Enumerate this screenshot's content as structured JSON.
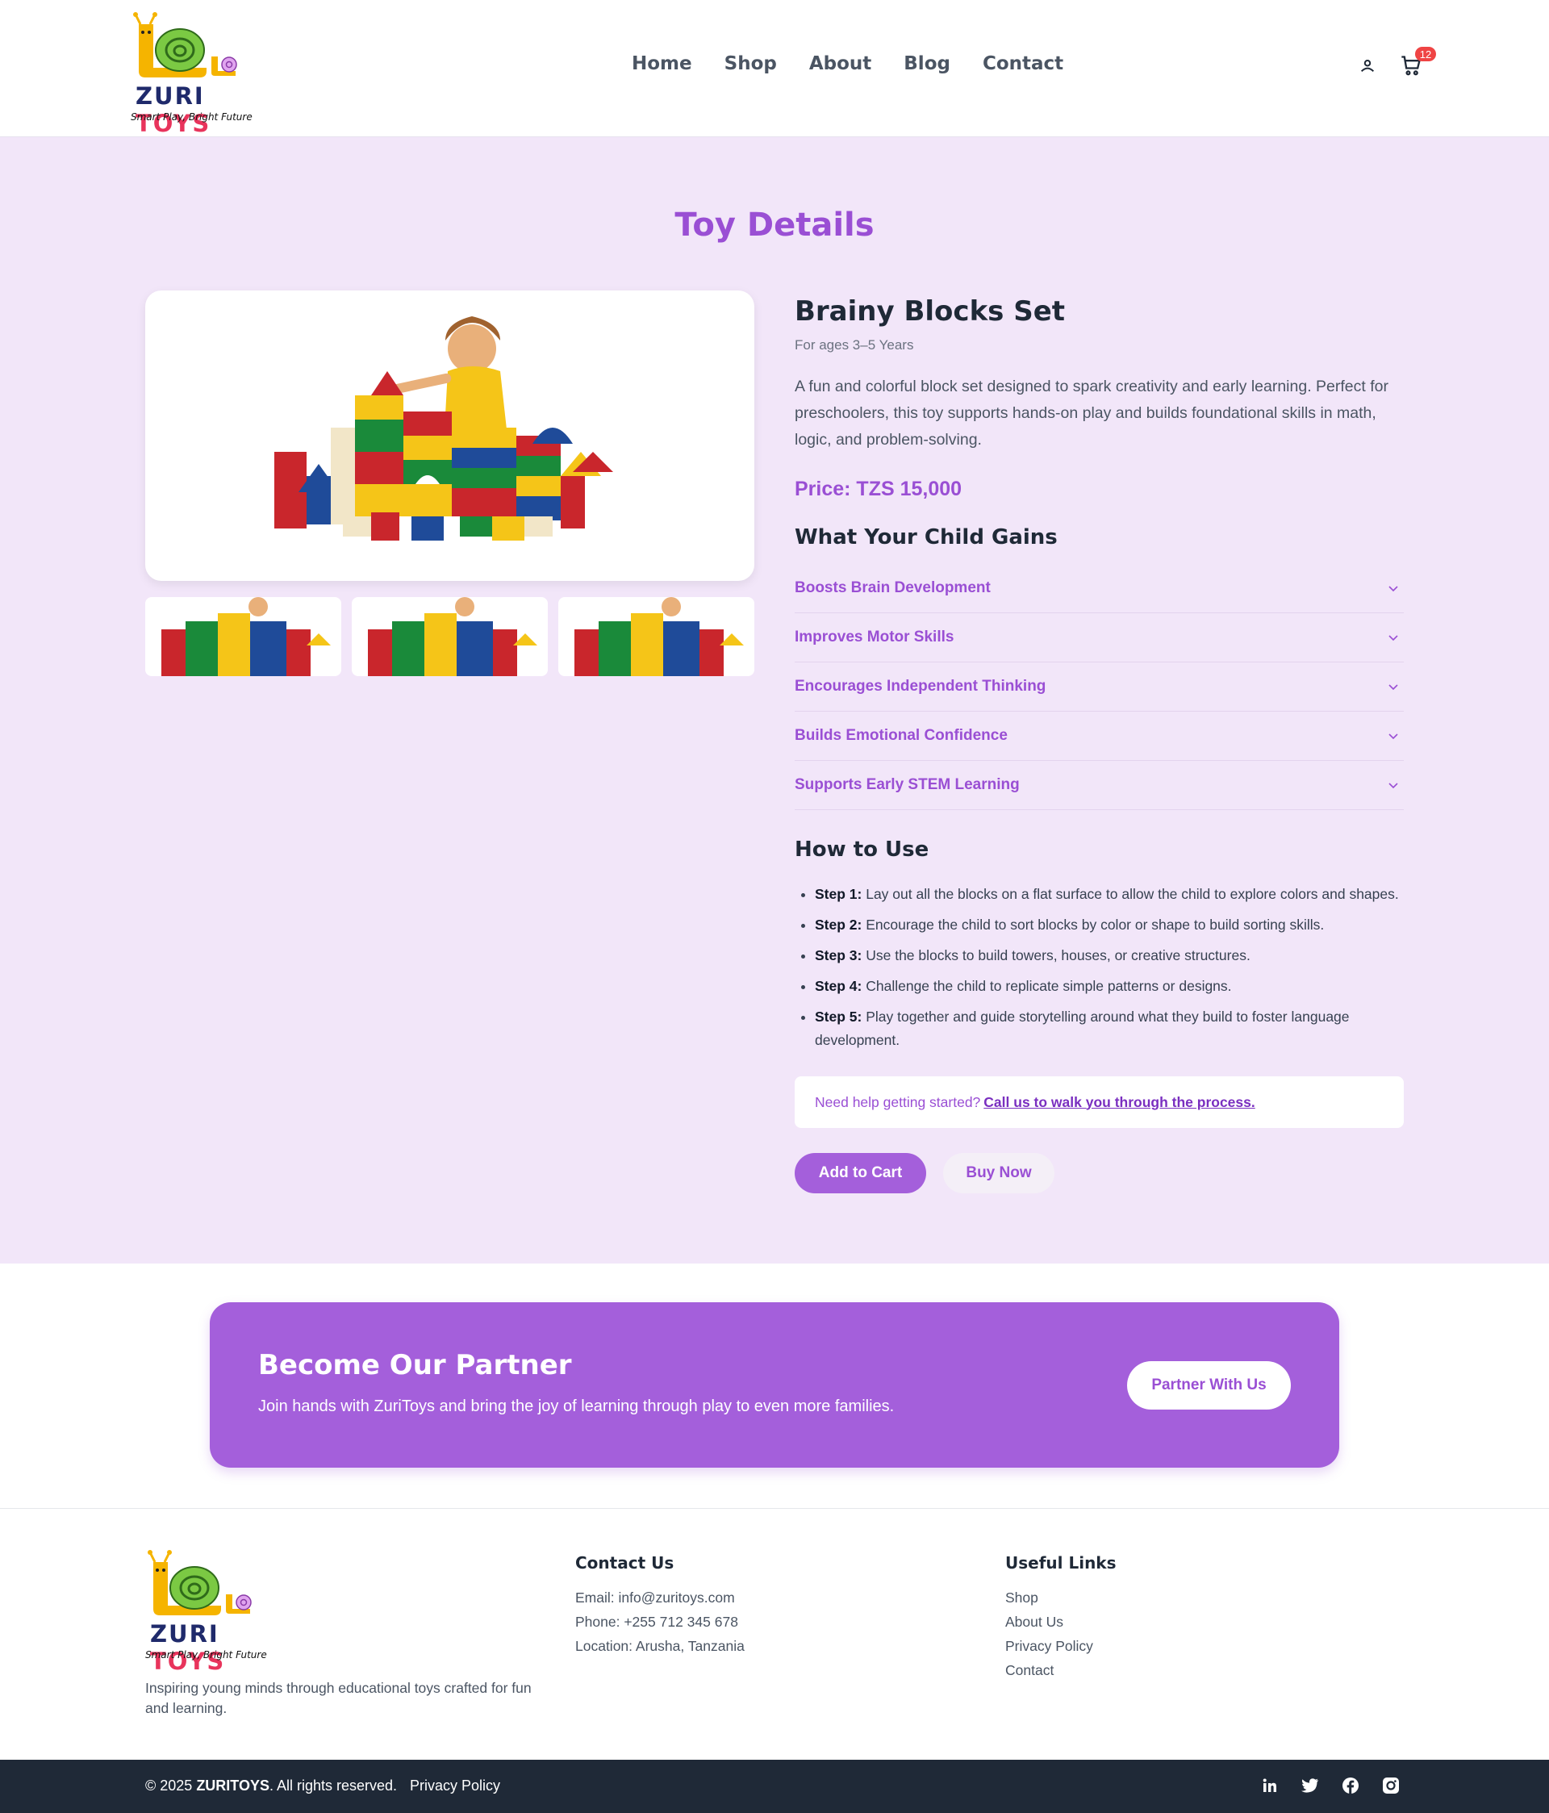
{
  "brand": {
    "name_part1": "ZURI",
    "name_part2": "TOYS",
    "tagline": "Smart Play, Bright Future"
  },
  "nav": {
    "items": [
      "Home",
      "Shop",
      "About",
      "Blog",
      "Contact"
    ]
  },
  "header": {
    "cart_count": "12",
    "icons": [
      "user-icon",
      "cart-icon"
    ]
  },
  "page": {
    "title": "Toy Details"
  },
  "product": {
    "name": "Brainy Blocks Set",
    "ages": "For ages 3–5 Years",
    "description": "A fun and colorful block set designed to spark creativity and early learning. Perfect for preschoolers, this toy supports hands-on play and builds foundational skills in math, logic, and problem-solving.",
    "price": "Price: TZS 15,000",
    "gains_heading": "What Your Child Gains",
    "gains": [
      "Boosts Brain Development",
      "Improves Motor Skills",
      "Encourages Independent Thinking",
      "Builds Emotional Confidence",
      "Supports Early STEM Learning"
    ],
    "howto_heading": "How to Use",
    "steps": [
      {
        "label": "Step 1:",
        "text": " Lay out all the blocks on a flat surface to allow the child to explore colors and shapes."
      },
      {
        "label": "Step 2:",
        "text": " Encourage the child to sort blocks by color or shape to build sorting skills."
      },
      {
        "label": "Step 3:",
        "text": " Use the blocks to build towers, houses, or creative structures."
      },
      {
        "label": "Step 4:",
        "text": " Challenge the child to replicate simple patterns or designs."
      },
      {
        "label": "Step 5:",
        "text": " Play together and guide storytelling around what they build to foster language development."
      }
    ],
    "help_text": "Need help getting started?",
    "help_link": "Call us to walk you through the process.",
    "add_to_cart": "Add to Cart",
    "buy_now": "Buy Now"
  },
  "partner": {
    "heading": "Become Our Partner",
    "text": "Join hands with ZuriToys and bring the joy of learning through play to even more families.",
    "button": "Partner With Us"
  },
  "footer": {
    "about": "Inspiring young minds through educational toys crafted for fun and learning.",
    "contact_heading": "Contact Us",
    "email": "Email: info@zuritoys.com",
    "phone": "Phone: +255 712 345 678",
    "location": "Location: Arusha, Tanzania",
    "links_heading": "Useful Links",
    "links": [
      "Shop",
      "About Us",
      "Privacy Policy",
      "Contact"
    ],
    "copyright_prefix": "© 2025 ",
    "copyright_brand": "ZURITOYS",
    "copyright_suffix": ". All rights reserved.",
    "privacy": "Privacy Policy",
    "socials": [
      "linkedin-icon",
      "twitter-icon",
      "facebook-icon",
      "instagram-icon"
    ]
  },
  "colors": {
    "accent": "#a45fdb",
    "accent_text": "#9a4fd4",
    "page_bg": "#f2e6f9",
    "footer_bar": "#1f2937"
  }
}
